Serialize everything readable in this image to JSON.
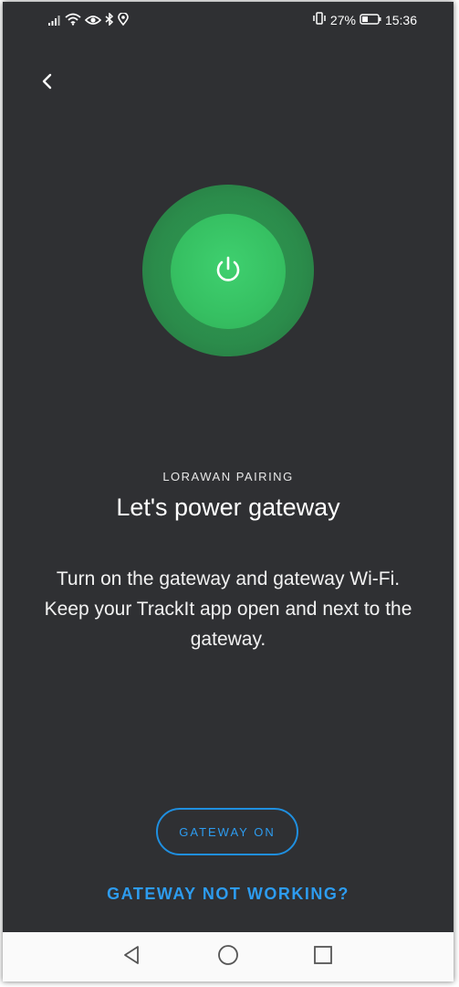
{
  "status_bar": {
    "battery_percent": "27%",
    "time": "15:36",
    "icons": [
      "signal-icon",
      "wifi-icon",
      "eye-icon",
      "bluetooth-icon",
      "location-icon",
      "vibrate-icon",
      "battery-icon"
    ]
  },
  "header": {
    "back_icon": "chevron-left-icon"
  },
  "hero": {
    "icon": "power-icon",
    "glow_color": "#3ccc6c"
  },
  "content": {
    "overline": "LORAWAN PAIRING",
    "title": "Let's power gateway",
    "description": "Turn on the gateway and gateway Wi-Fi. Keep your TrackIt app open and next to the gateway."
  },
  "actions": {
    "primary_label": "GATEWAY ON",
    "secondary_label": "GATEWAY NOT WORKING?",
    "accent_color": "#2d9cf0"
  },
  "nav": {
    "icons": [
      "back-triangle-icon",
      "home-circle-icon",
      "recents-square-icon"
    ]
  }
}
